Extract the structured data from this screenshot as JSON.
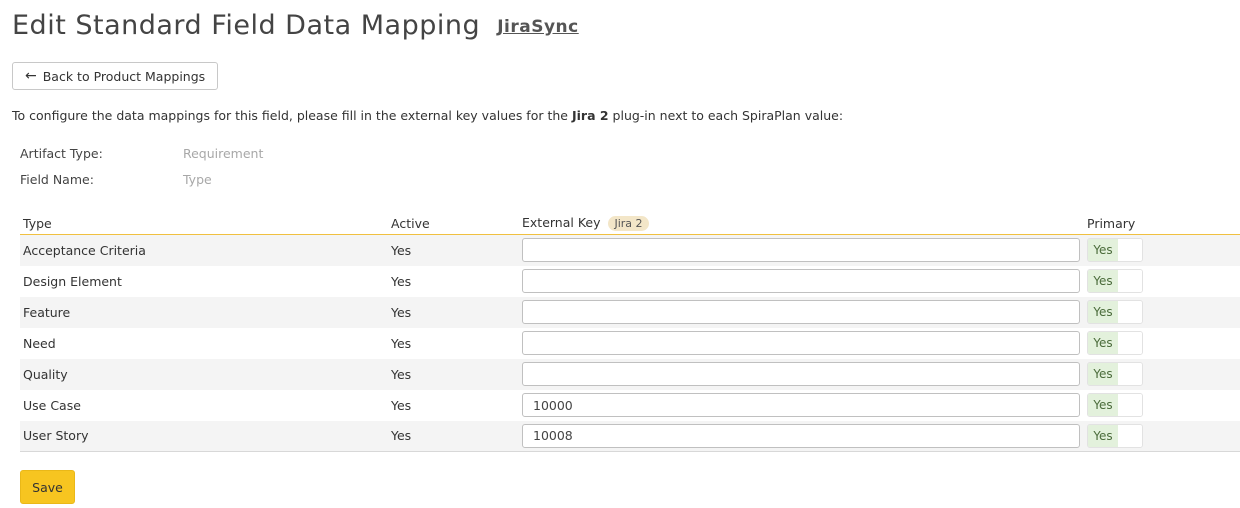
{
  "header": {
    "title": "Edit Standard Field Data Mapping",
    "product_link": "JiraSync"
  },
  "back_button": {
    "label": "Back to Product Mappings",
    "icon": "arrow-left-icon"
  },
  "instructions": {
    "before": "To configure the data mappings for this field, please fill in the external key values for the ",
    "plugin": "Jira 2",
    "after": " plug-in next to each SpiraPlan value:"
  },
  "meta": {
    "artifact_type_label": "Artifact Type:",
    "artifact_type_value": "Requirement",
    "field_name_label": "Field Name:",
    "field_name_value": "Type"
  },
  "table": {
    "headers": {
      "type": "Type",
      "active": "Active",
      "external_key": "External Key",
      "plugin_badge": "Jira 2",
      "primary": "Primary"
    },
    "rows": [
      {
        "type": "Acceptance Criteria",
        "active": "Yes",
        "external_key": "",
        "primary": "Yes"
      },
      {
        "type": "Design Element",
        "active": "Yes",
        "external_key": "",
        "primary": "Yes"
      },
      {
        "type": "Feature",
        "active": "Yes",
        "external_key": "",
        "primary": "Yes"
      },
      {
        "type": "Need",
        "active": "Yes",
        "external_key": "",
        "primary": "Yes"
      },
      {
        "type": "Quality",
        "active": "Yes",
        "external_key": "",
        "primary": "Yes"
      },
      {
        "type": "Use Case",
        "active": "Yes",
        "external_key": "10000",
        "primary": "Yes"
      },
      {
        "type": "User Story",
        "active": "Yes",
        "external_key": "10008",
        "primary": "Yes"
      }
    ]
  },
  "save_button": {
    "label": "Save"
  },
  "colors": {
    "header_underline": "#f0c040",
    "save_button": "#f7c520",
    "toggle_on": "#e3f1dc",
    "plugin_badge": "#f3e6c8"
  }
}
